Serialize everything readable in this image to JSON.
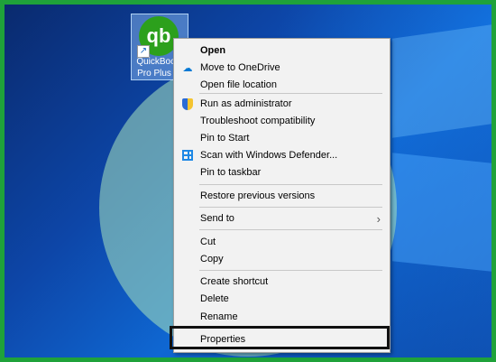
{
  "desktop": {
    "icon_label_line1": "QuickBooks",
    "icon_label_line2": "Pro Plus 20",
    "logo_text": "qb",
    "accent_green": "#1fa23a",
    "qb_green": "#2ca01c"
  },
  "context_menu": {
    "items": [
      {
        "label": "Open",
        "icon": ""
      },
      {
        "label": "Move to OneDrive",
        "icon": "onedrive-icon"
      },
      {
        "label": "Open file location",
        "icon": ""
      },
      {
        "label": "Run as administrator",
        "icon": "shield-icon"
      },
      {
        "label": "Troubleshoot compatibility",
        "icon": ""
      },
      {
        "label": "Pin to Start",
        "icon": ""
      },
      {
        "label": "Scan with Windows Defender...",
        "icon": "windows-defender-icon"
      },
      {
        "label": "Pin to taskbar",
        "icon": ""
      },
      {
        "label": "Restore previous versions",
        "icon": ""
      },
      {
        "label": "Send to",
        "icon": "",
        "submenu": true
      },
      {
        "label": "Cut",
        "icon": ""
      },
      {
        "label": "Copy",
        "icon": ""
      },
      {
        "label": "Create shortcut",
        "icon": ""
      },
      {
        "label": "Delete",
        "icon": ""
      },
      {
        "label": "Rename",
        "icon": ""
      },
      {
        "label": "Properties",
        "icon": ""
      }
    ],
    "submenu_chevron": "›",
    "highlighted_item": "Properties"
  }
}
